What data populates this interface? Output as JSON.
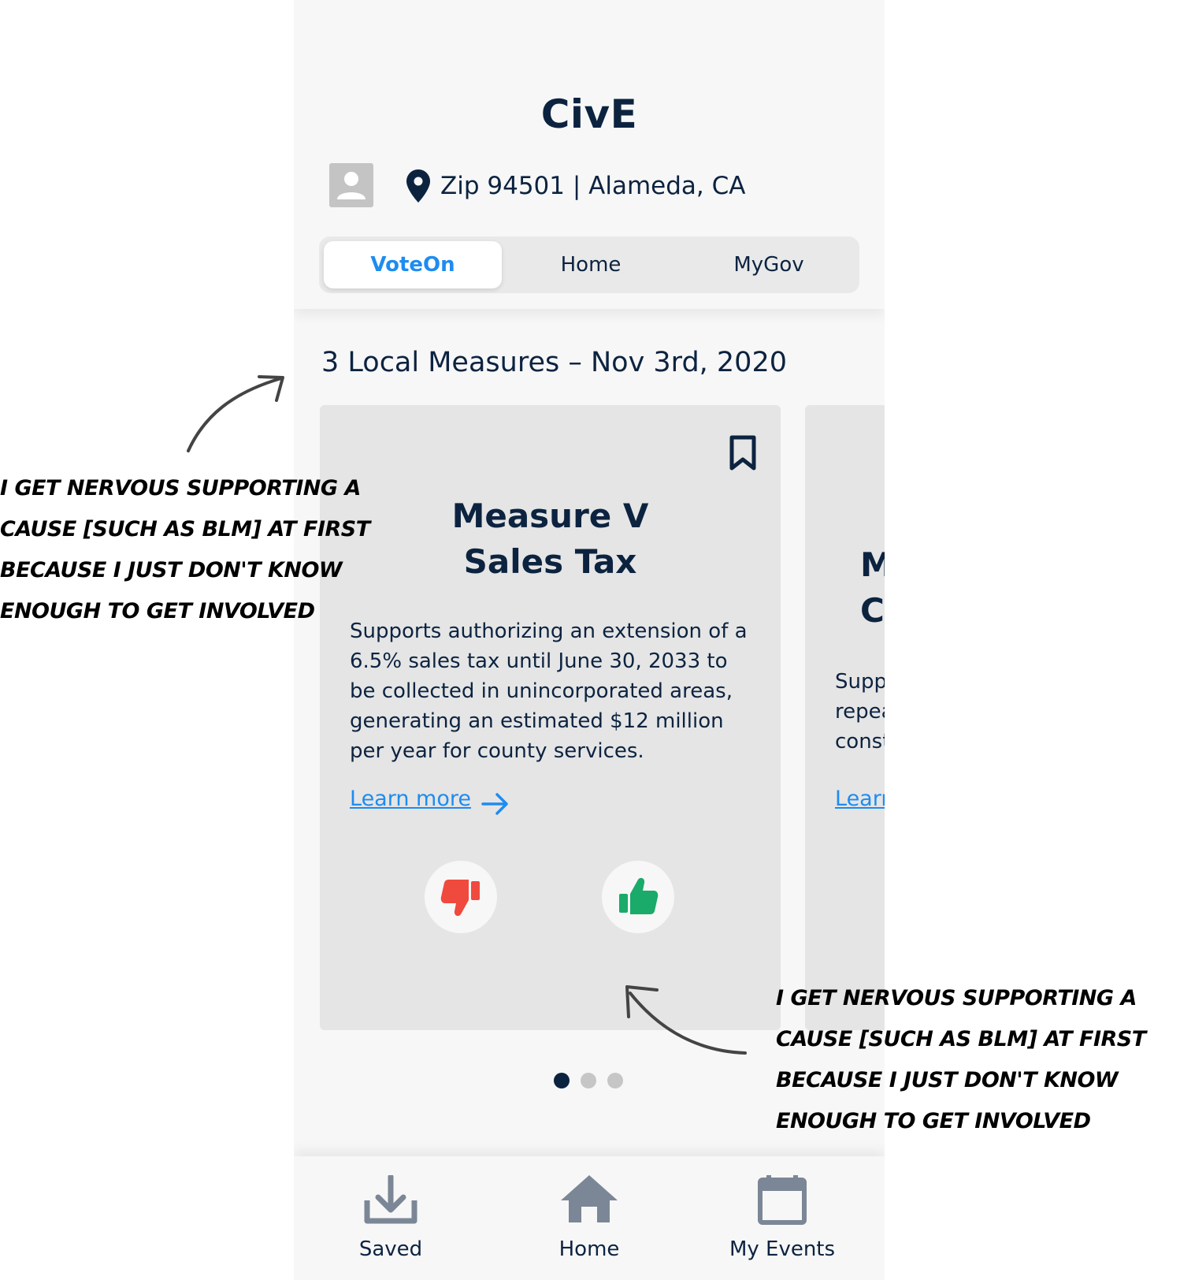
{
  "app": {
    "title": "CivE",
    "location": "Zip 94501 | Alameda, CA"
  },
  "tabs": [
    {
      "label": "VoteOn",
      "active": true
    },
    {
      "label": "Home",
      "active": false
    },
    {
      "label": "MyGov",
      "active": false
    }
  ],
  "section": {
    "title": "3 Local Measures – Nov 3rd, 2020"
  },
  "cards": [
    {
      "title_line1": "Measure V",
      "title_line2": "Sales Tax",
      "description": "Supports authorizing an extension of a 6.5% sales tax until June 30, 2033 to be collected in unincorporated areas, generating an estimated $12 million per year for county services.",
      "learn_more": "Learn more",
      "bookmark_icon": "bookmark-icon",
      "vote_down_icon": "thumbs-down-icon",
      "vote_up_icon": "thumbs-up-icon"
    },
    {
      "title_line1": "M",
      "title_line2": "C",
      "desc_line1": "Supp",
      "desc_line2": "repea",
      "desc_line3": "const",
      "learn_more": "Learn"
    }
  ],
  "pagination": {
    "count": 3,
    "active_index": 0
  },
  "bottom_nav": [
    {
      "label": "Saved",
      "icon": "download-icon"
    },
    {
      "label": "Home",
      "icon": "home-icon"
    },
    {
      "label": "My Events",
      "icon": "calendar-icon"
    }
  ],
  "annotations": [
    {
      "lines": [
        "I get nervous supporting a",
        "cause [such as BLM] at first",
        "because I just don't know",
        "enough to get involved"
      ]
    },
    {
      "lines": [
        "I get nervous supporting a",
        "cause [such as BLM] at first",
        "because I just don't know",
        "enough to get involved"
      ]
    }
  ],
  "colors": {
    "navy": "#0c2340",
    "accent_blue": "#1e8cf0",
    "dislike_red": "#f0493e",
    "like_green": "#1aaa6a",
    "icon_gray": "#7b8796"
  }
}
